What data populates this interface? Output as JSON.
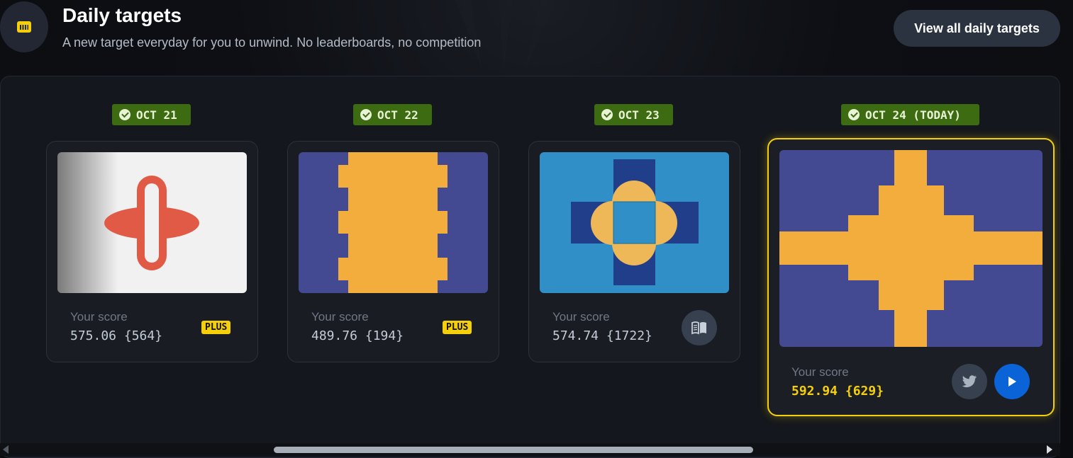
{
  "header": {
    "icon": "calendar-icon",
    "title": "Daily targets",
    "subtitle": "A new target everyday for you to unwind. No leaderboards, no competition",
    "view_all_label": "View all daily targets"
  },
  "colors": {
    "accent_yellow": "#f5d00a",
    "badge_green": "#3d6b12",
    "target_orange": "#f3ad3d",
    "target_indigo": "#444a92",
    "target_blue": "#2f8fc6",
    "target_red": "#e05a45"
  },
  "cards": [
    {
      "date": "OCT 21",
      "score_label": "Your score",
      "score_value": "575.06 {564}",
      "badge": "PLUS"
    },
    {
      "date": "OCT 22",
      "score_label": "Your score",
      "score_value": "489.76 {194}",
      "badge": "PLUS"
    },
    {
      "date": "OCT 23",
      "score_label": "Your score",
      "score_value": "574.74 {1722}",
      "action_icon": "book-icon"
    },
    {
      "date": "OCT 24 (TODAY)",
      "score_label": "Your score",
      "score_value": "592.94 {629}",
      "action_icons": [
        "twitter-icon",
        "play-icon"
      ]
    }
  ]
}
